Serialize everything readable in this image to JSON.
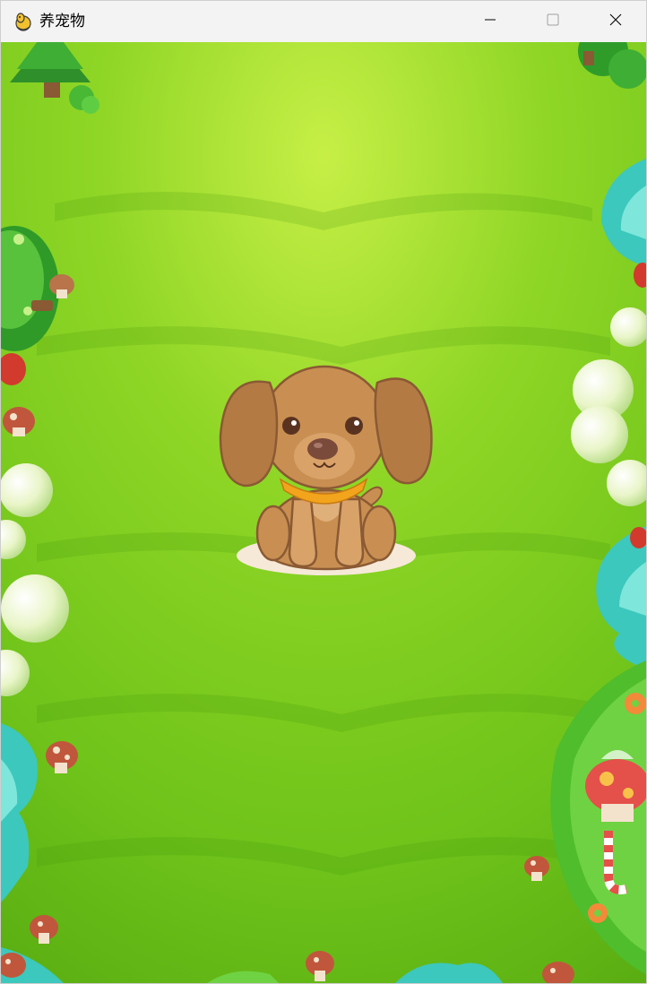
{
  "window": {
    "title": "养宠物",
    "app_icon": "pygame-snake-icon",
    "controls": {
      "minimize_icon": "minimize-icon",
      "maximize_icon": "maximize-icon",
      "close_icon": "close-icon"
    }
  },
  "scene": {
    "background": "grass-meadow",
    "pet": "puppy",
    "colors": {
      "grass_light": "#b8e63a",
      "grass_mid": "#7ccc1e",
      "grass_dark": "#5aae12",
      "pet_body": "#c98f52",
      "pet_ear": "#b47a44",
      "pet_collar": "#f2a41c",
      "pet_outline": "#8a5a34",
      "shadow": "#f6e9d8"
    }
  }
}
